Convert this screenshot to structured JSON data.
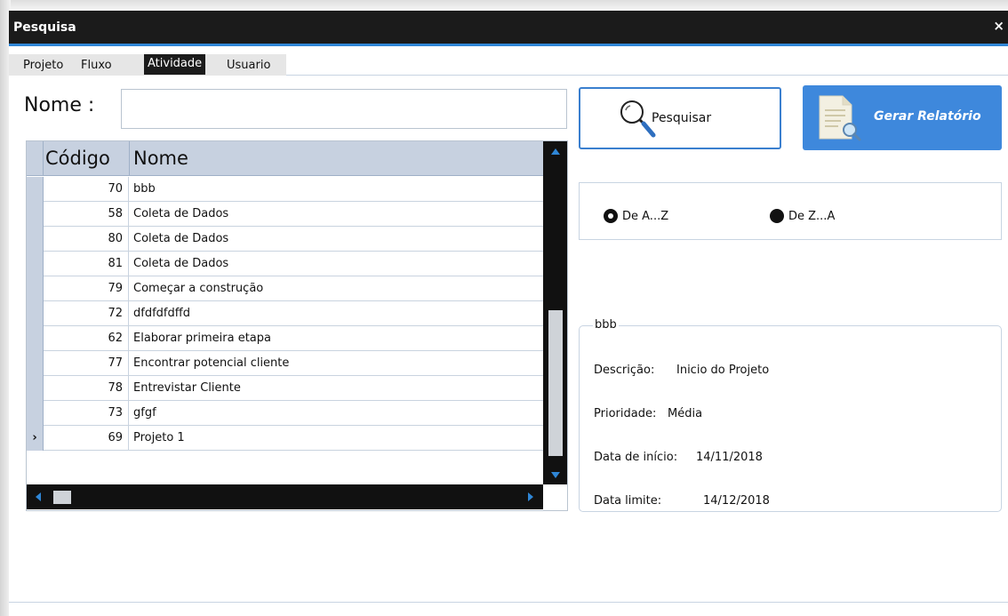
{
  "window": {
    "title": "Pesquisa",
    "close_label": "×"
  },
  "tabs": [
    {
      "label": "Projeto",
      "active": false
    },
    {
      "label": "Fluxo",
      "active": false
    },
    {
      "label": "Atividade",
      "active": true
    },
    {
      "label": "Usuario",
      "active": false
    }
  ],
  "search": {
    "label": "Nome :",
    "value": "",
    "placeholder": ""
  },
  "buttons": {
    "search_label": "Pesquisar",
    "report_label": "Gerar Relatório"
  },
  "grid": {
    "columns": [
      "Código",
      "Nome"
    ],
    "rows": [
      {
        "code": "70",
        "name": "bbb",
        "indicator": ""
      },
      {
        "code": "58",
        "name": "Coleta de Dados",
        "indicator": ""
      },
      {
        "code": "80",
        "name": "Coleta de Dados",
        "indicator": ""
      },
      {
        "code": "81",
        "name": "Coleta de Dados",
        "indicator": ""
      },
      {
        "code": "79",
        "name": "Começar a construção",
        "indicator": ""
      },
      {
        "code": "72",
        "name": "dfdfdfdffd",
        "indicator": ""
      },
      {
        "code": "62",
        "name": "Elaborar primeira etapa",
        "indicator": ""
      },
      {
        "code": "77",
        "name": "Encontrar potencial cliente",
        "indicator": ""
      },
      {
        "code": "78",
        "name": "Entrevistar Cliente",
        "indicator": ""
      },
      {
        "code": "73",
        "name": "gfgf",
        "indicator": ""
      },
      {
        "code": "69",
        "name": "Projeto 1",
        "indicator": "›"
      }
    ]
  },
  "order": {
    "options": [
      {
        "label": "De A...Z",
        "checked": true
      },
      {
        "label": "De Z...A",
        "checked": false
      }
    ]
  },
  "detail": {
    "legend": "bbb",
    "fields": [
      {
        "label": "Descrição:",
        "value": "Inicio do Projeto"
      },
      {
        "label": "Prioridade:",
        "value": "Média"
      },
      {
        "label": "Data de início:",
        "value": "14/11/2018"
      },
      {
        "label": "Data limite:",
        "value": "14/12/2018"
      }
    ]
  },
  "colors": {
    "accent": "#2f86d6",
    "titlebar": "#1b1b1b",
    "button_blue": "#3e88dc",
    "grid_header": "#c7d1e0"
  },
  "icons": {
    "search": "magnifier-icon",
    "report": "document-search-icon",
    "close": "close-icon",
    "row_pointer": "row-pointer-icon"
  }
}
